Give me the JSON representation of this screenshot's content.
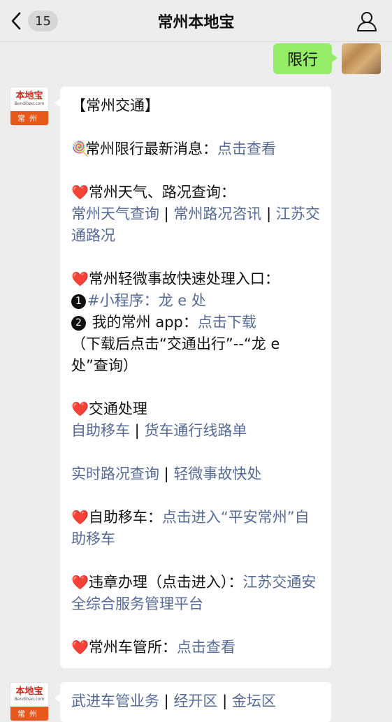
{
  "header": {
    "title": "常州本地宝",
    "unread_count": "15"
  },
  "outgoing": {
    "text": "限行"
  },
  "account_avatar": {
    "logo": "本地宝",
    "site": "Bendibao.com",
    "city": "常州"
  },
  "message1": {
    "heading": "【常州交通】",
    "p1": {
      "icon": "🍭",
      "text": "常州限行最新消息：",
      "link": "点击查看"
    },
    "p2": {
      "icon": "❤️",
      "text": "常州天气、路况查询：",
      "link_a": "常州天气查询",
      "sep1": " | ",
      "link_b": "常州路况咨讯",
      "sep2": " | ",
      "link_c": "江苏交通路况"
    },
    "p3": {
      "icon": "❤️",
      "text": "常州轻微事故快速处理入口：",
      "n1": "1",
      "link_1": "#小程序：龙 e 处",
      "n2": "2",
      "text_2": " 我的常州 app：",
      "link_2": "点击下载",
      "note": "（下载后点击“交通出行”--“龙 e 处”查询）"
    },
    "p4": {
      "icon": "❤️",
      "text": "交通处理",
      "link_a": "自助移车",
      "sep": " | ",
      "link_b": "货车通行线路单"
    },
    "p5": {
      "link_a": "实时路况查询",
      "sep": " | ",
      "link_b": "轻微事故快处"
    },
    "p6": {
      "icon": "❤️",
      "text": "自助移车：",
      "link": "点击进入“平安常州”自助移车"
    },
    "p7": {
      "icon": "❤️",
      "text": "违章办理（点击进入）：",
      "link": "江苏交通安全综合服务管理平台"
    },
    "p8": {
      "icon": "❤️",
      "text": "常州车管所：",
      "link": "点击查看"
    }
  },
  "message2": {
    "link_a": "武进车管业务",
    "sep1": " | ",
    "link_b": "经开区",
    "sep2": " | ",
    "link_c": "金坛区"
  }
}
